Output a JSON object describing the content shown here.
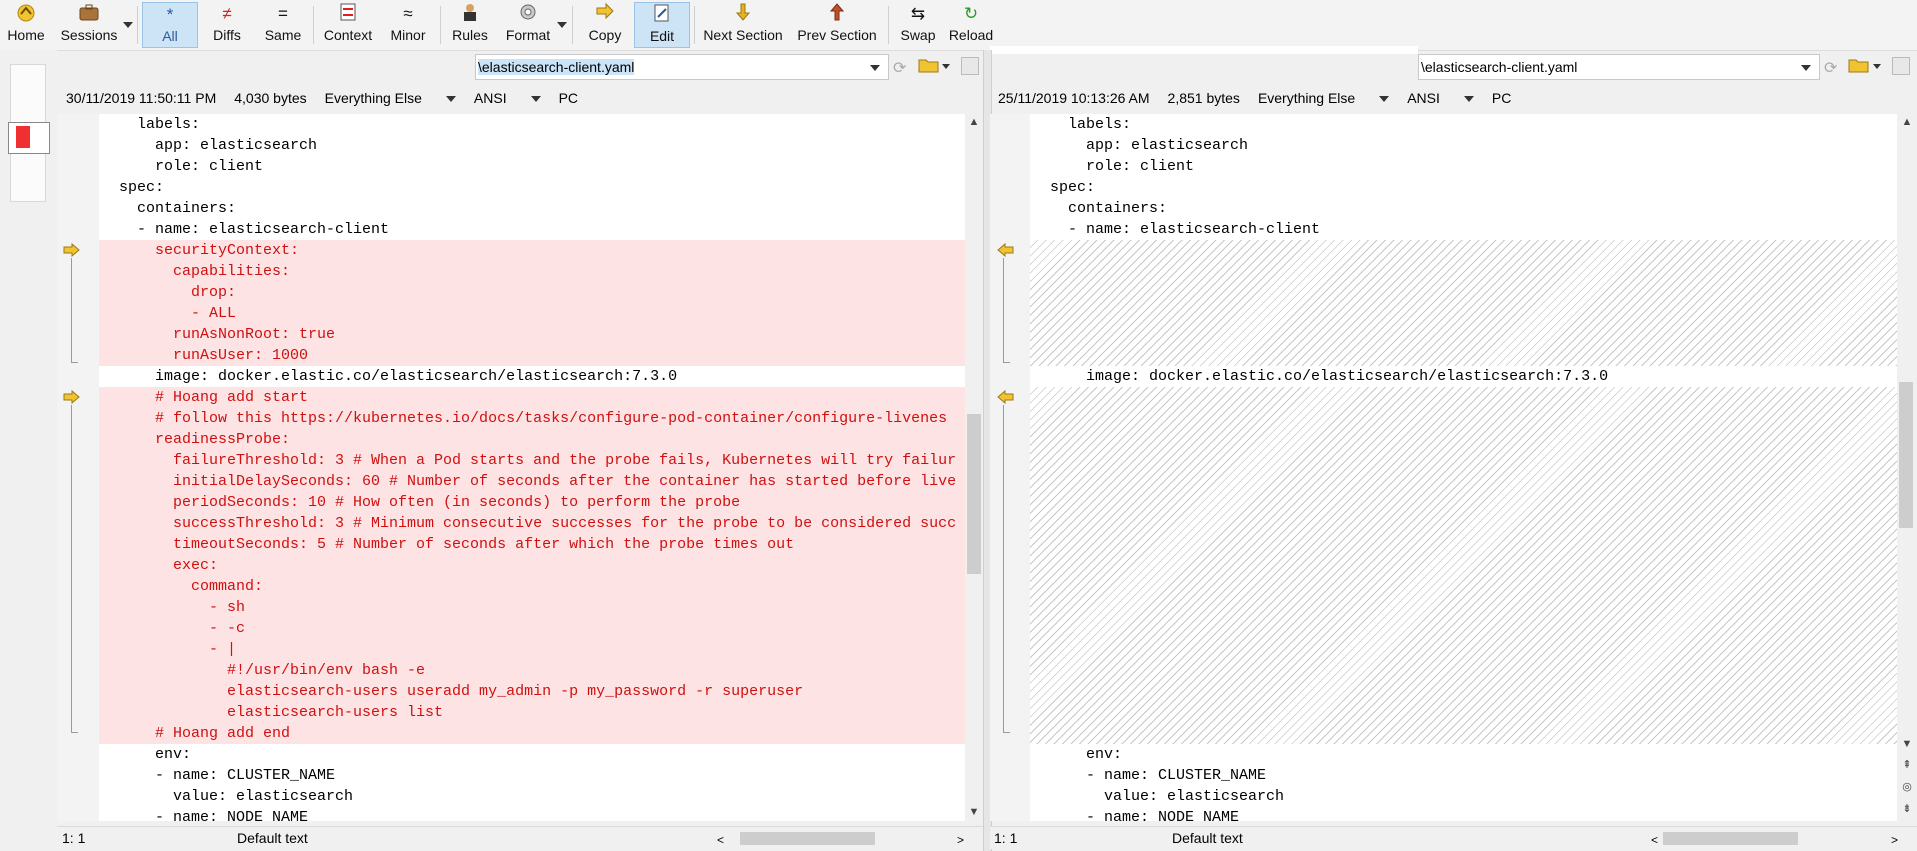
{
  "toolbar": {
    "home": "Home",
    "sessions": "Sessions",
    "all": "All",
    "diffs": "Diffs",
    "same": "Same",
    "context": "Context",
    "minor": "Minor",
    "rules": "Rules",
    "format": "Format",
    "copy": "Copy",
    "edit": "Edit",
    "next_section": "Next Section",
    "prev_section": "Prev Section",
    "swap": "Swap",
    "reload": "Reload"
  },
  "left": {
    "path": "\\elasticsearch-client.yaml",
    "timestamp": "30/11/2019 11:50:11 PM",
    "size": "4,030 bytes",
    "format": "Everything Else",
    "encoding": "ANSI",
    "line_ending": "PC",
    "status_pos": "1: 1",
    "status_text": "Default text"
  },
  "right": {
    "path": "\\elasticsearch-client.yaml",
    "timestamp": "25/11/2019 10:13:26 AM",
    "size": "2,851 bytes",
    "format": "Everything Else",
    "encoding": "ANSI",
    "line_ending": "PC",
    "status_pos": "1: 1",
    "status_text": "Default text"
  },
  "left_lines": [
    "    labels:",
    "      app: elasticsearch",
    "      role: client",
    "  spec:",
    "    containers:",
    "    - name: elasticsearch-client",
    "      securityContext:",
    "        capabilities:",
    "          drop:",
    "          - ALL",
    "        runAsNonRoot: true",
    "        runAsUser: 1000",
    "      image: docker.elastic.co/elasticsearch/elasticsearch:7.3.0",
    "      # Hoang add start",
    "      # follow this https://kubernetes.io/docs/tasks/configure-pod-container/configure-livenes",
    "      readinessProbe:",
    "        failureThreshold: 3 # When a Pod starts and the probe fails, Kubernetes will try failur",
    "        initialDelaySeconds: 60 # Number of seconds after the container has started before live",
    "        periodSeconds: 10 # How often (in seconds) to perform the probe",
    "        successThreshold: 3 # Minimum consecutive successes for the probe to be considered succ",
    "        timeoutSeconds: 5 # Number of seconds after which the probe times out",
    "        exec:",
    "          command:",
    "            - sh",
    "            - -c",
    "            - |",
    "              #!/usr/bin/env bash -e",
    "              elasticsearch-users useradd my_admin -p my_password -r superuser",
    "              elasticsearch-users list",
    "      # Hoang add end",
    "      env:",
    "      - name: CLUSTER_NAME",
    "        value: elasticsearch",
    "      - name: NODE_NAME"
  ],
  "right_lines": [
    "    labels:",
    "      app: elasticsearch",
    "      role: client",
    "  spec:",
    "    containers:",
    "    - name: elasticsearch-client",
    "      image: docker.elastic.co/elasticsearch/elasticsearch:7.3.0",
    "      env:",
    "      - name: CLUSTER_NAME",
    "        value: elasticsearch",
    "      - name: NODE_NAME"
  ],
  "colors": {
    "diff_text": "#d01010",
    "diff_bg": "#fde3e3",
    "active_button": "#cde4f7"
  }
}
